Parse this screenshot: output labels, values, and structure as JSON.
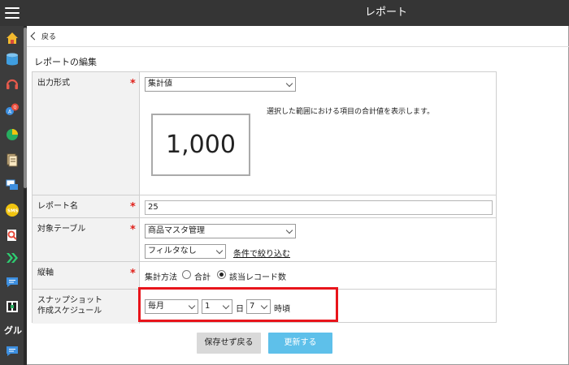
{
  "header": {
    "title": "レポート"
  },
  "sidebar": {
    "icons": [
      "home-icon",
      "database-icon",
      "headset-icon",
      "chat-search-icon",
      "pie-chart-icon",
      "document-icon",
      "windows-icon",
      "sms-icon",
      "search-doc-icon",
      "chevron-right-icon",
      "message-icon",
      "group-icon",
      "text-item",
      "message-icon"
    ],
    "text_item": "グル"
  },
  "nav": {
    "back_label": "戻る"
  },
  "page": {
    "section_title": "レポートの編集"
  },
  "form": {
    "output_format": {
      "label": "出力形式",
      "required_mark": "*",
      "selected": "集計値",
      "preview_value": "1,000",
      "description": "選択した範囲における項目の合計値を表示します。"
    },
    "report_name": {
      "label": "レポート名",
      "required_mark": "*",
      "value": "25"
    },
    "target_table": {
      "label": "対象テーブル",
      "required_mark": "*",
      "selected": "商品マスタ管理",
      "filter_selected": "フィルタなし",
      "filter_link": "条件で絞り込む"
    },
    "vertical_axis": {
      "label": "縦軸",
      "required_mark": "*",
      "method_label": "集計方法",
      "option_total": "合計",
      "option_count": "該当レコード数",
      "selected_option": "該当レコード数"
    },
    "snapshot": {
      "label_line1": "スナップショット",
      "label_line2": "作成スケジュール",
      "frequency": "毎月",
      "day": "1",
      "day_unit": "日",
      "hour": "7",
      "hour_unit": "時頃"
    }
  },
  "buttons": {
    "cancel_label": "保存せず戻る",
    "update_label": "更新する"
  },
  "colors": {
    "accent": "#5ec0ea",
    "required": "#e0201a",
    "highlight": "#e8141b",
    "topbar": "#353535"
  }
}
